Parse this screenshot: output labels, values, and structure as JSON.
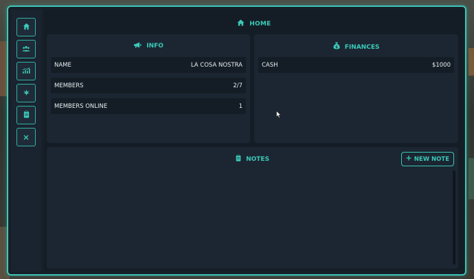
{
  "header": {
    "title": "HOME",
    "icon": "home-icon"
  },
  "sidebar": {
    "items": [
      {
        "icon": "home-icon",
        "glyph": "⌂"
      },
      {
        "icon": "users-icon",
        "glyph": "👥"
      },
      {
        "icon": "chart-icon",
        "glyph": "📈"
      },
      {
        "icon": "cannabis-icon",
        "glyph": "✿"
      },
      {
        "icon": "clipboard-icon",
        "glyph": "▤"
      },
      {
        "icon": "close-icon",
        "glyph": "✕"
      }
    ]
  },
  "info": {
    "title": "INFO",
    "icon": "megaphone-icon",
    "rows": [
      {
        "label": "NAME",
        "value": "LA COSA NOSTRA"
      },
      {
        "label": "MEMBERS",
        "value": "2/7"
      },
      {
        "label": "MEMBERS ONLINE",
        "value": "1"
      }
    ]
  },
  "finances": {
    "title": "FINANCES",
    "icon": "money-bag-icon",
    "rows": [
      {
        "label": "CASH",
        "value": "$1000"
      }
    ]
  },
  "notes": {
    "title": "NOTES",
    "icon": "clipboard-icon",
    "new_note_label": "NEW NOTE"
  },
  "colors": {
    "accent": "#3cc9b8",
    "panel": "#1b2632",
    "background": "#141d25"
  }
}
